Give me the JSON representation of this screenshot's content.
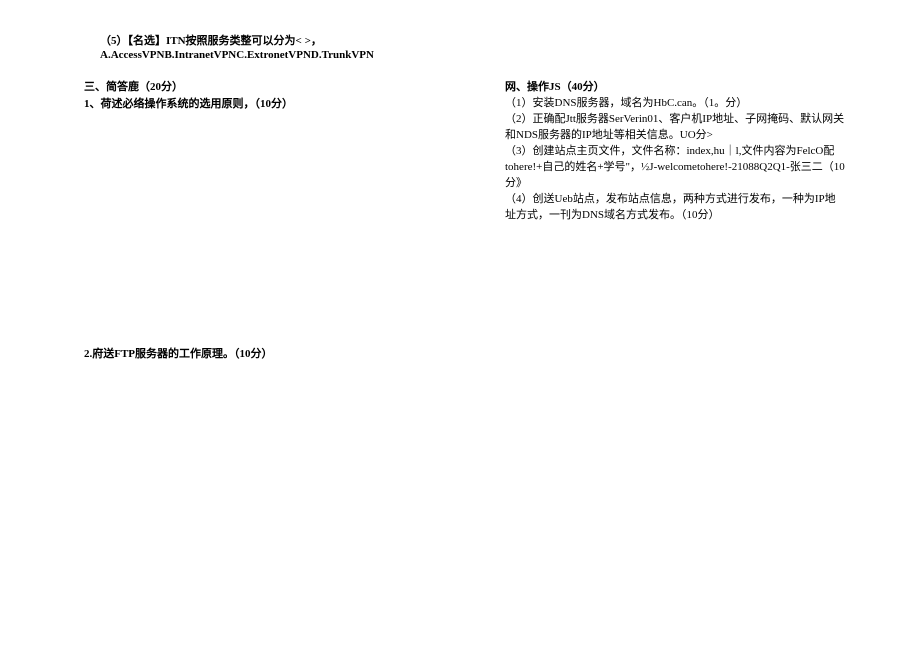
{
  "question5": {
    "line1": "（5）【名选】ITN按照服务类整可以分为<       >，",
    "line2": "A.AccessVPNB.IntranetVPNC.ExtronetVPND.TrunkVPN"
  },
  "section3": {
    "header": "三、简答鹿（20分）",
    "q1": "1、荷述必络操作系统的选用原则，（10分）"
  },
  "rightColumn": {
    "line0": "网、操作JS（40分）",
    "line1": "（1）安装DNS服务器，域名为HbC.can。（1。分）",
    "line2": "（2）正确配Jtt服务器SerVerin01、客户机IP地址、子网掩码、默认网关和NDS服务器的IP地址等相关信息。UO分>",
    "line3": "（3）创建站点主页文件，文件名称：index,hu｜l,文件内容为FelcO配tohere!+自己的姓名+学号\"，½J-welcometohere!-21088Q2Q1-张三二（10分》",
    "line4": "（4）创送Ueb站点，发布站点信息，两种方式进行发布，一种为IP地址方式，一刊为DNS域名方式发布。（10分）"
  },
  "q2": "2.府送FTP服务器的工作原理。（10分）"
}
